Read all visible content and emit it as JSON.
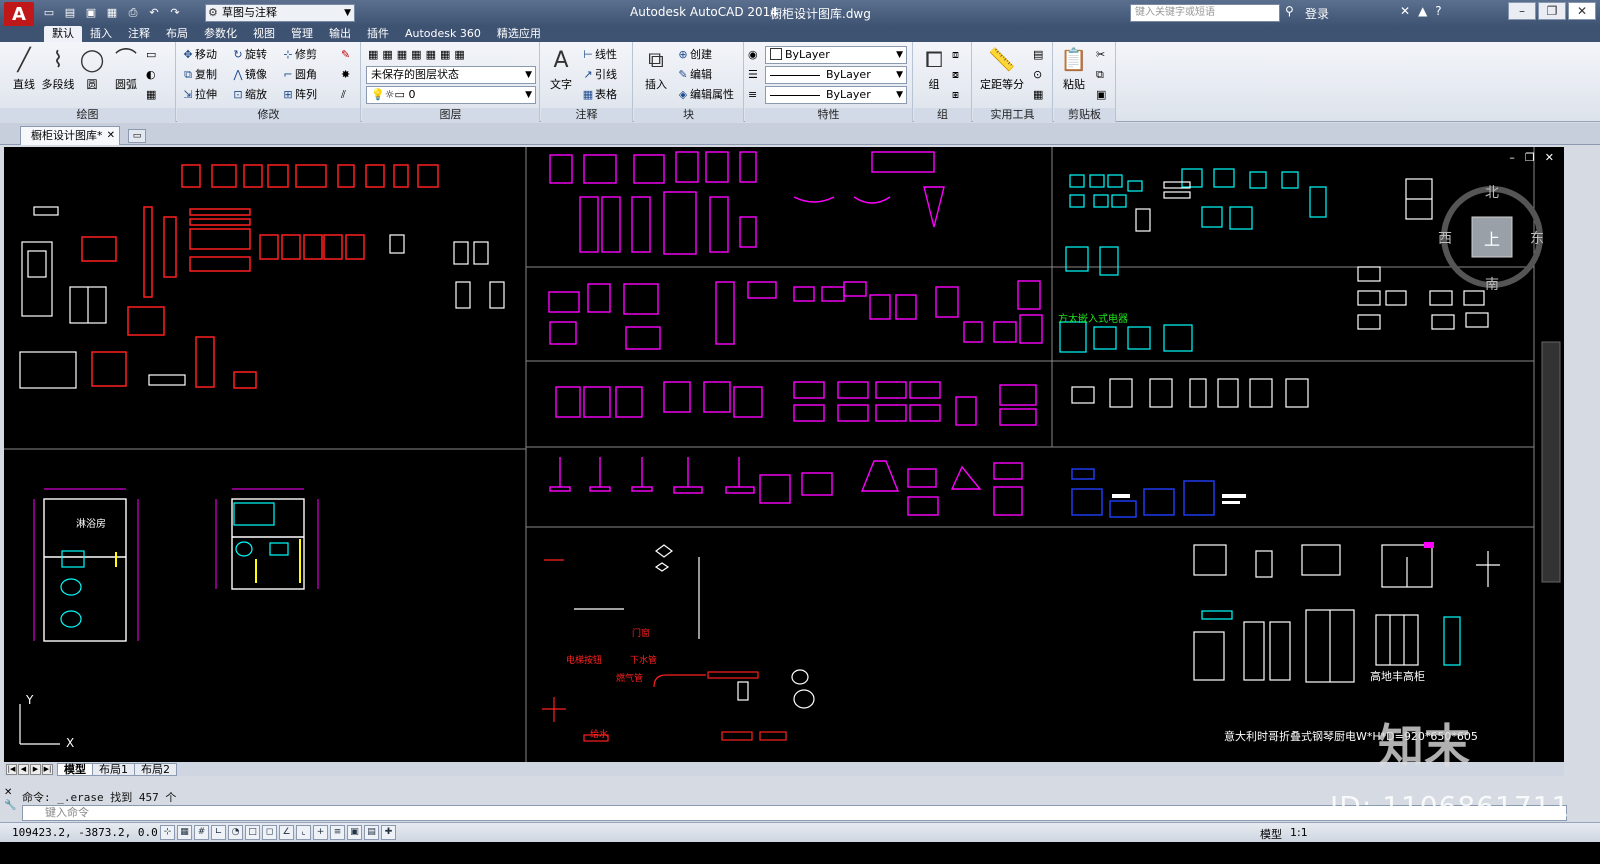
{
  "titlebar": {
    "logo": "A",
    "workspace": "草图与注释",
    "app_title": "Autodesk AutoCAD 2014",
    "doc_title": "橱柜设计图库.dwg",
    "search_placeholder": "键入关键字或短语",
    "login": "登录"
  },
  "ribbon_tabs": [
    "默认",
    "插入",
    "注释",
    "布局",
    "参数化",
    "视图",
    "管理",
    "输出",
    "插件",
    "Autodesk 360",
    "精选应用"
  ],
  "ribbon": {
    "draw": {
      "title": "绘图",
      "line": "直线",
      "polyline": "多段线",
      "circle": "圆",
      "arc": "圆弧"
    },
    "modify": {
      "title": "修改",
      "move": "移动",
      "rotate": "旋转",
      "trim": "修剪",
      "copy": "复制",
      "mirror": "镜像",
      "fillet": "圆角",
      "stretch": "拉伸",
      "scale": "缩放",
      "array": "阵列"
    },
    "layers": {
      "title": "图层",
      "layer_state": "未保存的图层状态",
      "current_layer": "0"
    },
    "annotation": {
      "title": "注释",
      "text": "文字",
      "linear": "线性",
      "leader": "引线",
      "table": "表格"
    },
    "block": {
      "title": "块",
      "insert": "插入",
      "create": "创建",
      "edit": "编辑",
      "edit_attr": "编辑属性"
    },
    "properties": {
      "title": "特性",
      "color": "ByLayer",
      "linetype": "ByLayer",
      "lineweight": "ByLayer"
    },
    "groups": {
      "title": "组",
      "group": "组"
    },
    "utilities": {
      "title": "实用工具",
      "measure": "定距等分"
    },
    "clipboard": {
      "title": "剪贴板",
      "paste": "粘贴"
    }
  },
  "file_tab": "橱柜设计图库*",
  "viewcube": {
    "north": "北",
    "south": "南",
    "east": "东",
    "west": "西",
    "top": "上"
  },
  "drawing_labels": {
    "shower_room": "淋浴房",
    "embedded": "方太嵌入式电器",
    "tall_cabinet": "高地丰高柜",
    "piano_range": "意大利时哥折叠式钢琴厨电W*H*D=920*650*605",
    "door_label": "门窗",
    "label_a": "电梯按钮",
    "label_b": "下水管",
    "label_c": "燃气管",
    "label_d": "给水",
    "ucs_y": "Y",
    "ucs_x": "X"
  },
  "layout_tabs": [
    "模型",
    "布局1",
    "布局2"
  ],
  "command": {
    "history": "命令: _.erase 找到 457 个",
    "placeholder": "键入命令"
  },
  "status": {
    "coords": "109423.2, -3873.2, 0.0",
    "model": "模型",
    "scale": "1:1"
  },
  "watermark": {
    "brand": "知末",
    "id": "ID: 1106861711"
  },
  "colors": {
    "magenta": "#ff00ff",
    "red": "#ff2020",
    "cyan": "#00ffff",
    "white": "#ffffff",
    "blue": "#2040ff",
    "yellow": "#ffff00",
    "green": "#20e020"
  }
}
